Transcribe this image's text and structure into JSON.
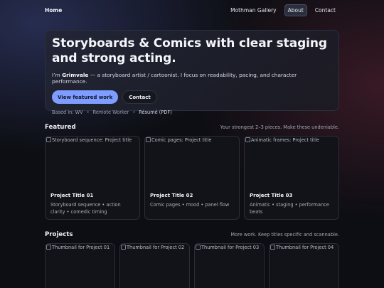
{
  "nav": {
    "brand": "Home",
    "links": [
      {
        "label": "Mothman Gallery"
      },
      {
        "label": "About",
        "active": true
      },
      {
        "label": "Contact"
      }
    ]
  },
  "hero": {
    "title": "Storyboards & Comics with clear staging and strong acting.",
    "lead_prefix": "I’m ",
    "lead_name": "Grimvale",
    "lead_suffix": " — a storyboard artist / cartoonist. I focus on readability, pacing, and character performance.",
    "primary_button": "View featured work",
    "secondary_button": "Contact",
    "meta": {
      "based_in": "Based in: WV",
      "remote": "Remote Worker",
      "resume": "Résumé (PDF)",
      "separator": "•"
    }
  },
  "featured": {
    "title": "Featured",
    "subtitle": "Your strongest 2–3 pieces. Make these undeniable.",
    "cards": [
      {
        "image_alt": "Storyboard sequence: Project title",
        "title": "Project Title 01",
        "desc": "Storyboard sequence • action clarity • comedic timing"
      },
      {
        "image_alt": "Comic pages: Project title",
        "title": "Project Title 02",
        "desc": "Comic pages • mood • panel flow"
      },
      {
        "image_alt": "Animatic frames: Project title",
        "title": "Project Title 03",
        "desc": "Animatic • staging • performance beats"
      }
    ]
  },
  "projects": {
    "title": "Projects",
    "subtitle": "More work. Keep titles specific and scannable.",
    "thumbs": [
      {
        "image_alt": "Thumbnail for Project 01"
      },
      {
        "image_alt": "Thumbnail for Project 02"
      },
      {
        "image_alt": "Thumbnail for Project 03"
      },
      {
        "image_alt": "Thumbnail for Project 04"
      }
    ]
  },
  "colors": {
    "accent": "#7f9dff",
    "background": "#0d0e13"
  },
  "icons": {
    "broken_image": "broken-image-icon"
  }
}
